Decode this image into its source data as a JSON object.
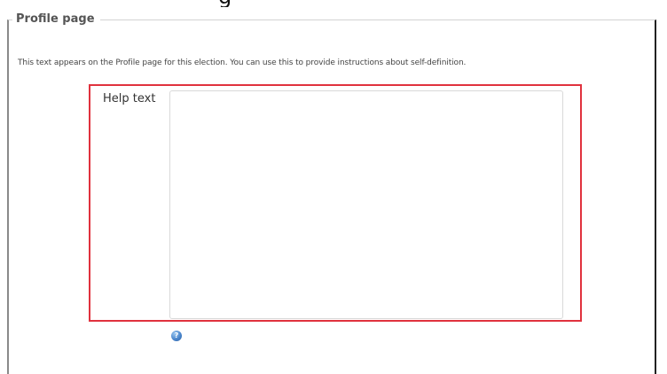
{
  "section": {
    "legend": "Profile page",
    "description": "This text appears on the Profile page for this election. You can use this to provide instructions about self-definition."
  },
  "help_text_field": {
    "label": "Help text",
    "value": ""
  },
  "help_icon": {
    "icon": "help-icon",
    "glyph": "?"
  },
  "colors": {
    "highlight": "#e0323e",
    "help_icon": "#4a86cc"
  }
}
